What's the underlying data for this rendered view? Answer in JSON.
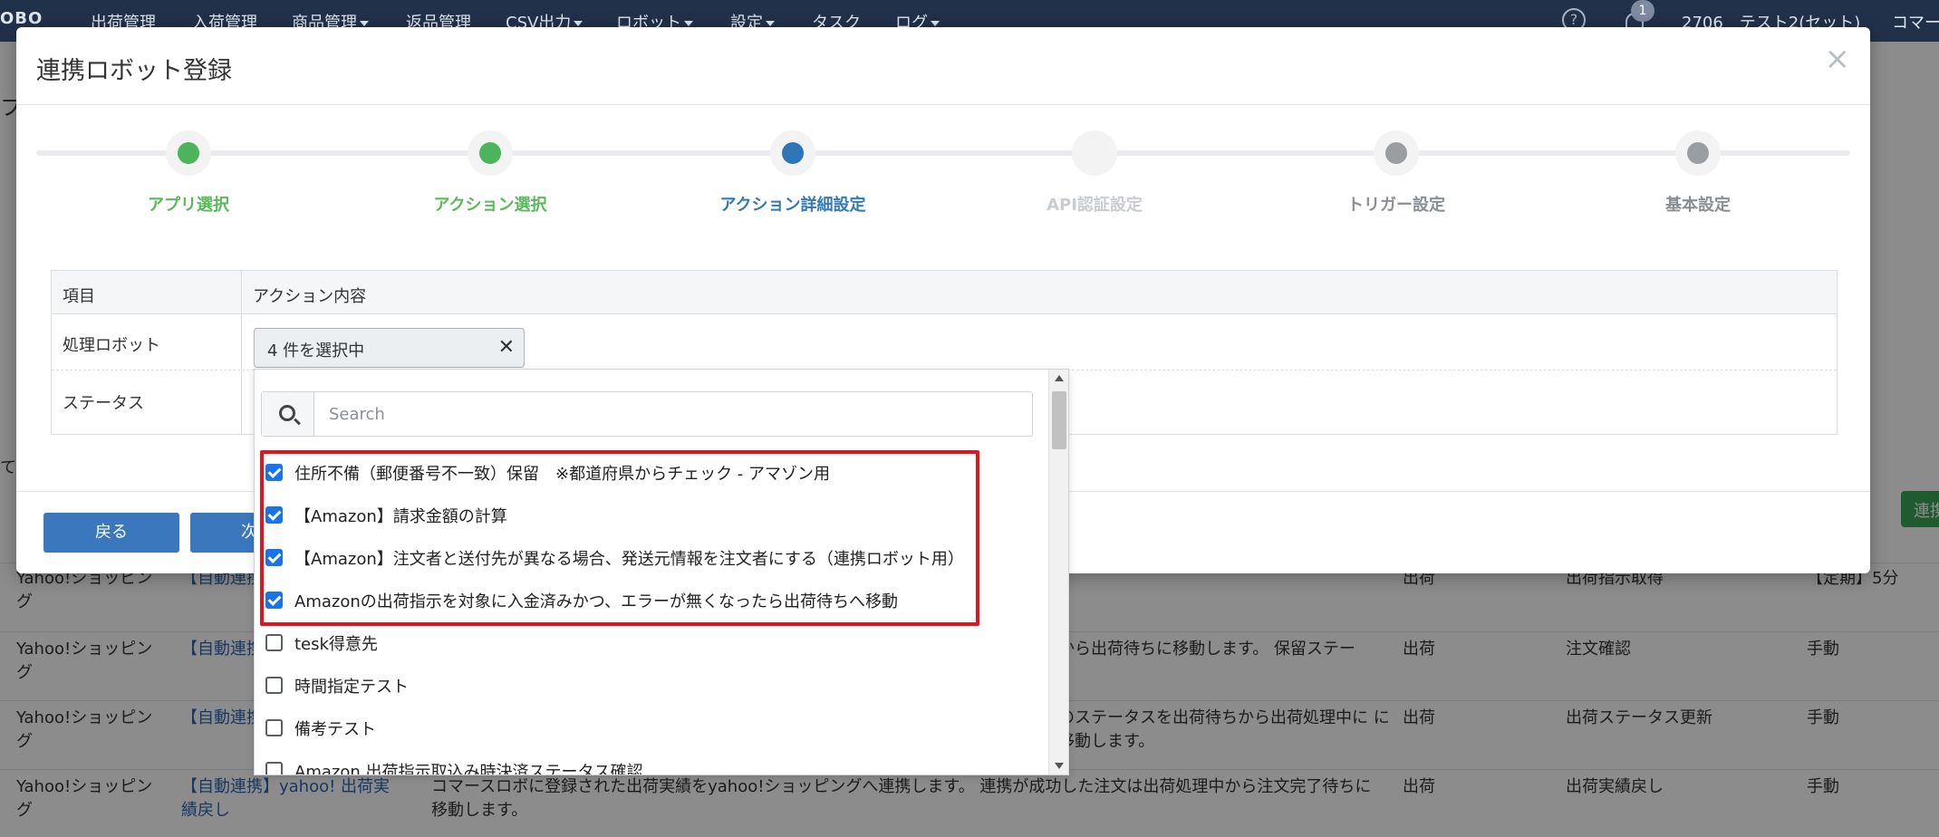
{
  "topnav": {
    "logo": "OBO",
    "items": [
      {
        "label": "出荷管理",
        "caret": false
      },
      {
        "label": "入荷管理",
        "caret": false
      },
      {
        "label": "商品管理",
        "caret": true
      },
      {
        "label": "返品管理",
        "caret": false
      },
      {
        "label": "CSV出力",
        "caret": true
      },
      {
        "label": "ロボット",
        "caret": true
      },
      {
        "label": "設定",
        "caret": true
      },
      {
        "label": "タスク",
        "caret": false
      },
      {
        "label": "ログ",
        "caret": true
      }
    ],
    "help_icon": "question-circle-icon",
    "bell_icon": "bell-icon",
    "notification_count": "1",
    "user": "2706　テスト2(セット)",
    "org": "コマー"
  },
  "background": {
    "left_fragment_1": "フ",
    "left_fragment_2": "て",
    "green_button": "連携",
    "rows": [
      {
        "c1": "Yahoo!ショッピング",
        "c2": "【自動連携】取得（差分",
        "c3": "",
        "c4": "出荷",
        "c5": "出荷指示取得",
        "c6": "【定期】5分"
      },
      {
        "c1": "Yahoo!ショッピング",
        "c2": "【自動連携】",
        "c3": "から出荷待ちに移動します。 保留ステー",
        "c4": "出荷",
        "c5": "注文確認",
        "c6": "手動"
      },
      {
        "c1": "Yahoo!ショッピング",
        "c2": "【自動連携】ータス更新",
        "c3": "のステータスを出荷待ちから出荷処理中に に移動します。",
        "c4": "出荷",
        "c5": "出荷ステータス更新",
        "c6": "手動"
      },
      {
        "c1": "Yahoo!ショッピング",
        "c2": "【自動連携】yahoo! 出荷実績戻し",
        "c3": "コマースロボに登録された出荷実績をyahoo!ショッピングへ連携します。 連携が成功した注文は出荷処理中から注文完了待ちに 移動します。",
        "c4": "出荷",
        "c5": "出荷実績戻し",
        "c6": "手動"
      }
    ]
  },
  "modal": {
    "title": "連携ロボット登録",
    "close_icon": "close-icon",
    "steps": [
      {
        "label": "アプリ選択",
        "state": "done",
        "color": "#5cb85c",
        "dot": "#4cb45a"
      },
      {
        "label": "アクション選択",
        "state": "done",
        "color": "#5cb85c",
        "dot": "#4cb45a"
      },
      {
        "label": "アクション詳細設定",
        "state": "active",
        "color": "#337ab7",
        "dot": "#2f75b8"
      },
      {
        "label": "API認証設定",
        "state": "pending",
        "color": "#c9ccd0",
        "dot": ""
      },
      {
        "label": "トリガー設定",
        "state": "todo",
        "color": "#8a8f96",
        "dot": "#9a9da2"
      },
      {
        "label": "基本設定",
        "state": "todo",
        "color": "#8a8f96",
        "dot": "#9a9da2"
      }
    ],
    "table": {
      "head_col1": "項目",
      "head_col2": "アクション内容",
      "row1_label": "処理ロボット",
      "row2_label": "ステータス"
    },
    "select": {
      "value": "4 件を選択中",
      "clear_icon": "clear-x-icon"
    },
    "footer": {
      "back": "戻る",
      "next": "次"
    }
  },
  "dropdown": {
    "search_placeholder": "Search",
    "search_icon": "search-icon",
    "options": [
      {
        "label": "住所不備（郵便番号不一致）保留　※都道府県からチェック - アマゾン用",
        "checked": true
      },
      {
        "label": "【Amazon】請求金額の計算",
        "checked": true
      },
      {
        "label": "【Amazon】注文者と送付先が異なる場合、発送元情報を注文者にする（連携ロボット用）",
        "checked": true
      },
      {
        "label": "Amazonの出荷指示を対象に入金済みかつ、エラーが無くなったら出荷待ちへ移動",
        "checked": true
      },
      {
        "label": "tesk得意先",
        "checked": false
      },
      {
        "label": "時間指定テスト",
        "checked": false
      },
      {
        "label": "備考テスト",
        "checked": false
      },
      {
        "label": "Amazon 出荷指示取込み時決済ステータス確認",
        "checked": false
      }
    ],
    "highlight_color": "#e3141d"
  }
}
